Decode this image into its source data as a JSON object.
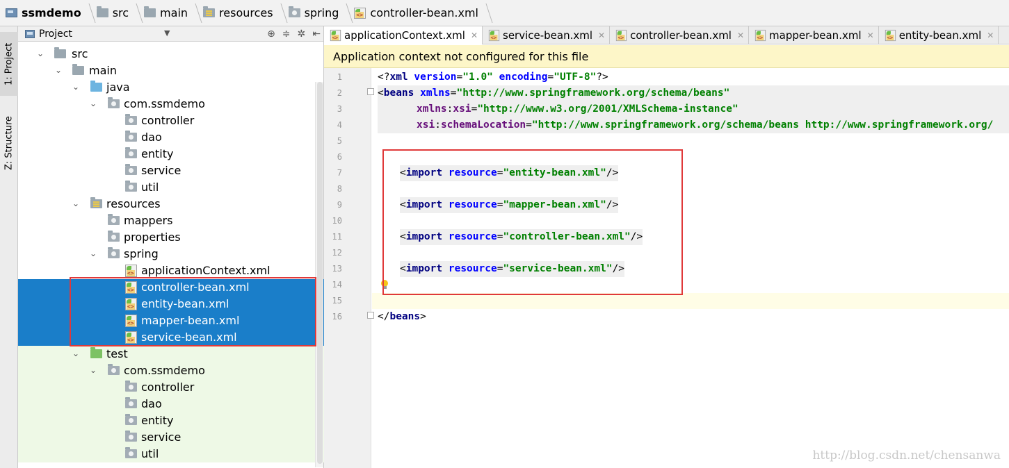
{
  "breadcrumb": [
    "ssmdemo",
    "src",
    "main",
    "resources",
    "spring",
    "controller-bean.xml"
  ],
  "toolstrip": {
    "project_tab": "1: Project",
    "structure_tab": "Z: Structure"
  },
  "panel": {
    "title": "Project"
  },
  "tree": [
    {
      "label": "src"
    },
    {
      "label": "main"
    },
    {
      "label": "java"
    },
    {
      "label": "com.ssmdemo"
    },
    {
      "label": "controller"
    },
    {
      "label": "dao"
    },
    {
      "label": "entity"
    },
    {
      "label": "service"
    },
    {
      "label": "util"
    },
    {
      "label": "resources"
    },
    {
      "label": "mappers"
    },
    {
      "label": "properties"
    },
    {
      "label": "spring"
    },
    {
      "label": "applicationContext.xml"
    },
    {
      "label": "controller-bean.xml"
    },
    {
      "label": "entity-bean.xml"
    },
    {
      "label": "mapper-bean.xml"
    },
    {
      "label": "service-bean.xml"
    },
    {
      "label": "test"
    },
    {
      "label": "com.ssmdemo"
    },
    {
      "label": "controller"
    },
    {
      "label": "dao"
    },
    {
      "label": "entity"
    },
    {
      "label": "service"
    },
    {
      "label": "util"
    }
  ],
  "tabs": [
    "applicationContext.xml",
    "service-bean.xml",
    "controller-bean.xml",
    "mapper-bean.xml",
    "entity-bean.xml"
  ],
  "warning": "Application context not configured for this file",
  "line_numbers": [
    "1",
    "2",
    "3",
    "4",
    "5",
    "6",
    "7",
    "8",
    "9",
    "10",
    "11",
    "12",
    "13",
    "14",
    "15",
    "16"
  ],
  "code": {
    "l1_open": "<?",
    "l1_tag": "xml",
    "l1_a1": " version",
    "l1_eq1": "=",
    "l1_v1": "\"1.0\"",
    "l1_a2": " encoding",
    "l1_eq2": "=",
    "l1_v2": "\"UTF-8\"",
    "l1_close": "?>",
    "l2_open": "<",
    "l2_tag": "beans",
    "l2_a1": " xmlns",
    "l2_eq1": "=",
    "l2_v1": "\"http://www.springframework.org/schema/beans\"",
    "l3_ns": "xmlns",
    "l3_colon": ":",
    "l3_attr": "xsi",
    "l3_eq": "=",
    "l3_val": "\"http://www.w3.org/2001/XMLSchema-instance\"",
    "l4_ns": "xsi",
    "l4_colon": ":",
    "l4_attr": "schemaLocation",
    "l4_eq": "=",
    "l4_val": "\"http://www.springframework.org/schema/beans http://www.springframework.org/",
    "imp_open": "<",
    "imp_tag": "import",
    "imp_attr": " resource",
    "imp_eq": "=",
    "imp_close": "/>",
    "l7_val": "\"entity-bean.xml\"",
    "l9_val": "\"mapper-bean.xml\"",
    "l11_val": "\"controller-bean.xml\"",
    "l13_val": "\"service-bean.xml\"",
    "l16_open": "</",
    "l16_tag": "beans",
    "l16_close": ">"
  },
  "watermark": "http://blog.csdn.net/chensanwa"
}
